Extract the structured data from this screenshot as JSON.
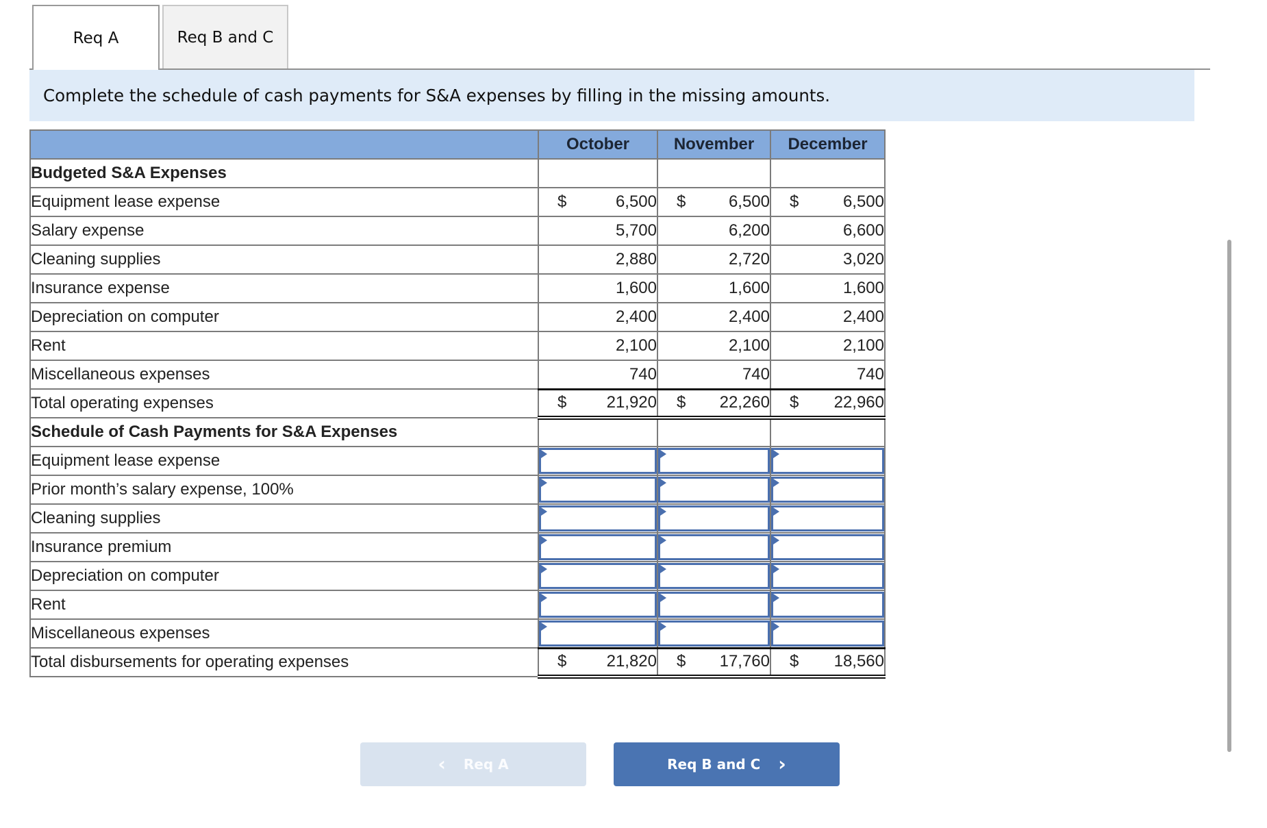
{
  "tabs": [
    {
      "label": "Req A",
      "active": true
    },
    {
      "label": "Req B and C",
      "active": false
    }
  ],
  "instruction": "Complete the schedule of cash payments for S&A expenses by filling in the missing amounts.",
  "table": {
    "columns": [
      "October",
      "November",
      "December"
    ],
    "budgeted_section": {
      "title": "Budgeted S&A Expenses",
      "rows": [
        {
          "label": "Equipment lease expense",
          "dollar": true,
          "values": [
            "6,500",
            "6,500",
            "6,500"
          ]
        },
        {
          "label": "Salary expense",
          "dollar": false,
          "values": [
            "5,700",
            "6,200",
            "6,600"
          ]
        },
        {
          "label": "Cleaning supplies",
          "dollar": false,
          "values": [
            "2,880",
            "2,720",
            "3,020"
          ]
        },
        {
          "label": "Insurance expense",
          "dollar": false,
          "values": [
            "1,600",
            "1,600",
            "1,600"
          ]
        },
        {
          "label": "Depreciation on computer",
          "dollar": false,
          "values": [
            "2,400",
            "2,400",
            "2,400"
          ]
        },
        {
          "label": "Rent",
          "dollar": false,
          "values": [
            "2,100",
            "2,100",
            "2,100"
          ]
        },
        {
          "label": "Miscellaneous expenses",
          "dollar": false,
          "values": [
            "740",
            "740",
            "740"
          ]
        }
      ],
      "total": {
        "label": "Total operating expenses",
        "dollar": "$",
        "values": [
          "21,920",
          "22,260",
          "22,960"
        ]
      }
    },
    "cash_section": {
      "title": "Schedule of Cash Payments for S&A Expenses",
      "rows": [
        {
          "label": "Equipment lease expense",
          "values": [
            "",
            "",
            ""
          ]
        },
        {
          "label": "Prior month’s salary expense, 100%",
          "values": [
            "",
            "",
            ""
          ]
        },
        {
          "label": "Cleaning supplies",
          "values": [
            "",
            "",
            ""
          ]
        },
        {
          "label": "Insurance premium",
          "values": [
            "",
            "",
            ""
          ]
        },
        {
          "label": "Depreciation on computer",
          "values": [
            "",
            "",
            ""
          ]
        },
        {
          "label": "Rent",
          "values": [
            "",
            "",
            ""
          ]
        },
        {
          "label": "Miscellaneous expenses",
          "values": [
            "",
            "",
            ""
          ]
        }
      ],
      "total": {
        "label": "Total disbursements for operating expenses",
        "dollar": "$",
        "values": [
          "21,820",
          "17,760",
          "18,560"
        ]
      }
    },
    "dollar_sign": "$"
  },
  "nav": {
    "prev_label": "Req A",
    "prev_icon": "chevron-left-icon",
    "next_label": "Req B and C",
    "next_icon": "chevron-right-icon",
    "prev_glyph": "‹",
    "next_glyph": "›"
  },
  "colors": {
    "header_bg": "#84aadc",
    "banner_bg": "#dfebf8",
    "input_border": "#4a6fae",
    "next_button": "#4a74b2",
    "prev_button_disabled": "#d9e3ef"
  }
}
